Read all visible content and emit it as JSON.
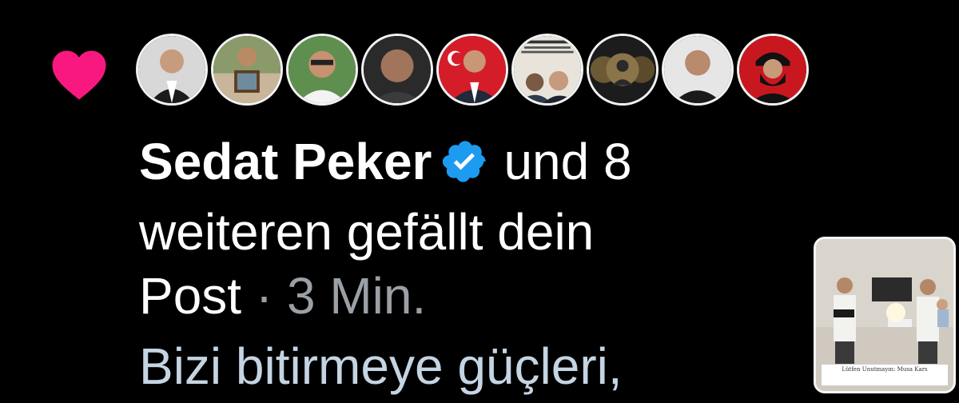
{
  "notification": {
    "icon": "heart-icon",
    "heart_color": "#f91880",
    "liker_name": "Sedat Peker",
    "verified_badge": "verified-badge-icon",
    "verified_color": "#1d9bf0",
    "likers_suffix": "und 8",
    "line2": "weiteren gefällt dein",
    "post_word": "Post",
    "separator": "·",
    "time_ago": "3 Min.",
    "post_text": "Bizi bitirmeye güçleri,",
    "avatar_count": 9,
    "thumbnail_caption": "Lütfen Unutmayın: Musa Kars"
  }
}
